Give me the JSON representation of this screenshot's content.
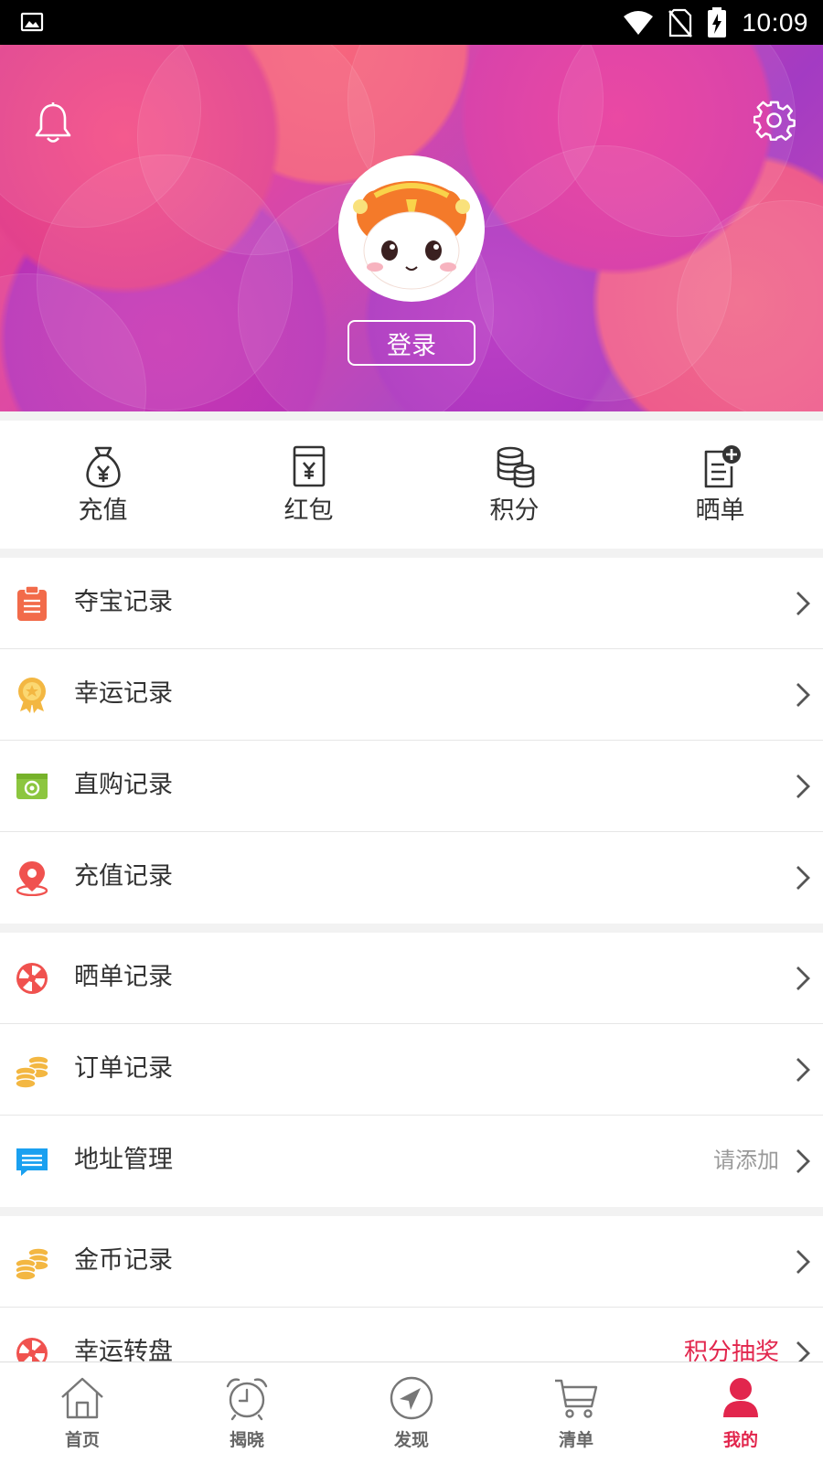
{
  "status_bar": {
    "time": "10:09"
  },
  "header": {
    "login_label": "登录"
  },
  "quick_actions": [
    {
      "label": "充值",
      "icon": "money-bag-icon"
    },
    {
      "label": "红包",
      "icon": "red-envelope-icon"
    },
    {
      "label": "积分",
      "icon": "coin-stack-icon"
    },
    {
      "label": "晒单",
      "icon": "add-note-icon"
    }
  ],
  "group1": [
    {
      "label": "夺宝记录",
      "icon": "clipboard-icon",
      "value": ""
    },
    {
      "label": "幸运记录",
      "icon": "medal-icon",
      "value": ""
    },
    {
      "label": "直购记录",
      "icon": "camera-card-icon",
      "value": ""
    },
    {
      "label": "充值记录",
      "icon": "location-pin-icon",
      "value": ""
    }
  ],
  "group2": [
    {
      "label": "晒单记录",
      "icon": "wheel-icon",
      "value": ""
    },
    {
      "label": "订单记录",
      "icon": "coins-icon",
      "value": ""
    },
    {
      "label": "地址管理",
      "icon": "message-icon",
      "value": "请添加"
    }
  ],
  "group3": [
    {
      "label": "金币记录",
      "icon": "coins-icon",
      "value": ""
    },
    {
      "label": "幸运转盘",
      "icon": "wheel-icon",
      "value": "积分抽奖"
    }
  ],
  "bottom_nav": [
    {
      "label": "首页",
      "icon": "home-icon"
    },
    {
      "label": "揭晓",
      "icon": "alarm-clock-icon"
    },
    {
      "label": "发现",
      "icon": "compass-icon"
    },
    {
      "label": "清单",
      "icon": "cart-icon"
    },
    {
      "label": "我的",
      "icon": "user-icon"
    }
  ],
  "colors": {
    "accent": "#e2264d",
    "text": "#333333",
    "muted": "#9a9a9a"
  }
}
